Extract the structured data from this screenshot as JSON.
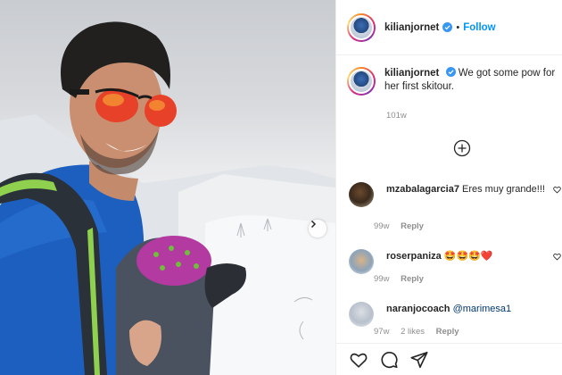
{
  "post": {
    "username": "kilianjornet",
    "follow_label": "Follow",
    "separator": "•",
    "caption": "We got some pow for her first skitour.",
    "timestamp": "101w"
  },
  "comments": [
    {
      "username": "mzabalagarcia7",
      "text": "Eres muy grande!!!",
      "time": "99w",
      "likes": "",
      "reply": "Reply"
    },
    {
      "username": "roserpaniza",
      "text": "🤩🤩🤩❤️",
      "time": "99w",
      "likes": "",
      "reply": "Reply"
    },
    {
      "username": "naranjocoach",
      "text": "@marimesa1",
      "time": "97w",
      "likes": "2 likes",
      "reply": "Reply"
    }
  ],
  "icons": {
    "header_avatar": "avatar-ring",
    "verified": "verified-badge-icon",
    "next": "chevron-right-icon",
    "more_comments": "plus-circle-icon",
    "like": "heart-icon",
    "comment": "comment-icon",
    "share": "share-icon"
  },
  "colors": {
    "follow": "#0095f6",
    "verified": "#3897f0",
    "meta": "#8e8e8e",
    "mention": "#00376b"
  }
}
